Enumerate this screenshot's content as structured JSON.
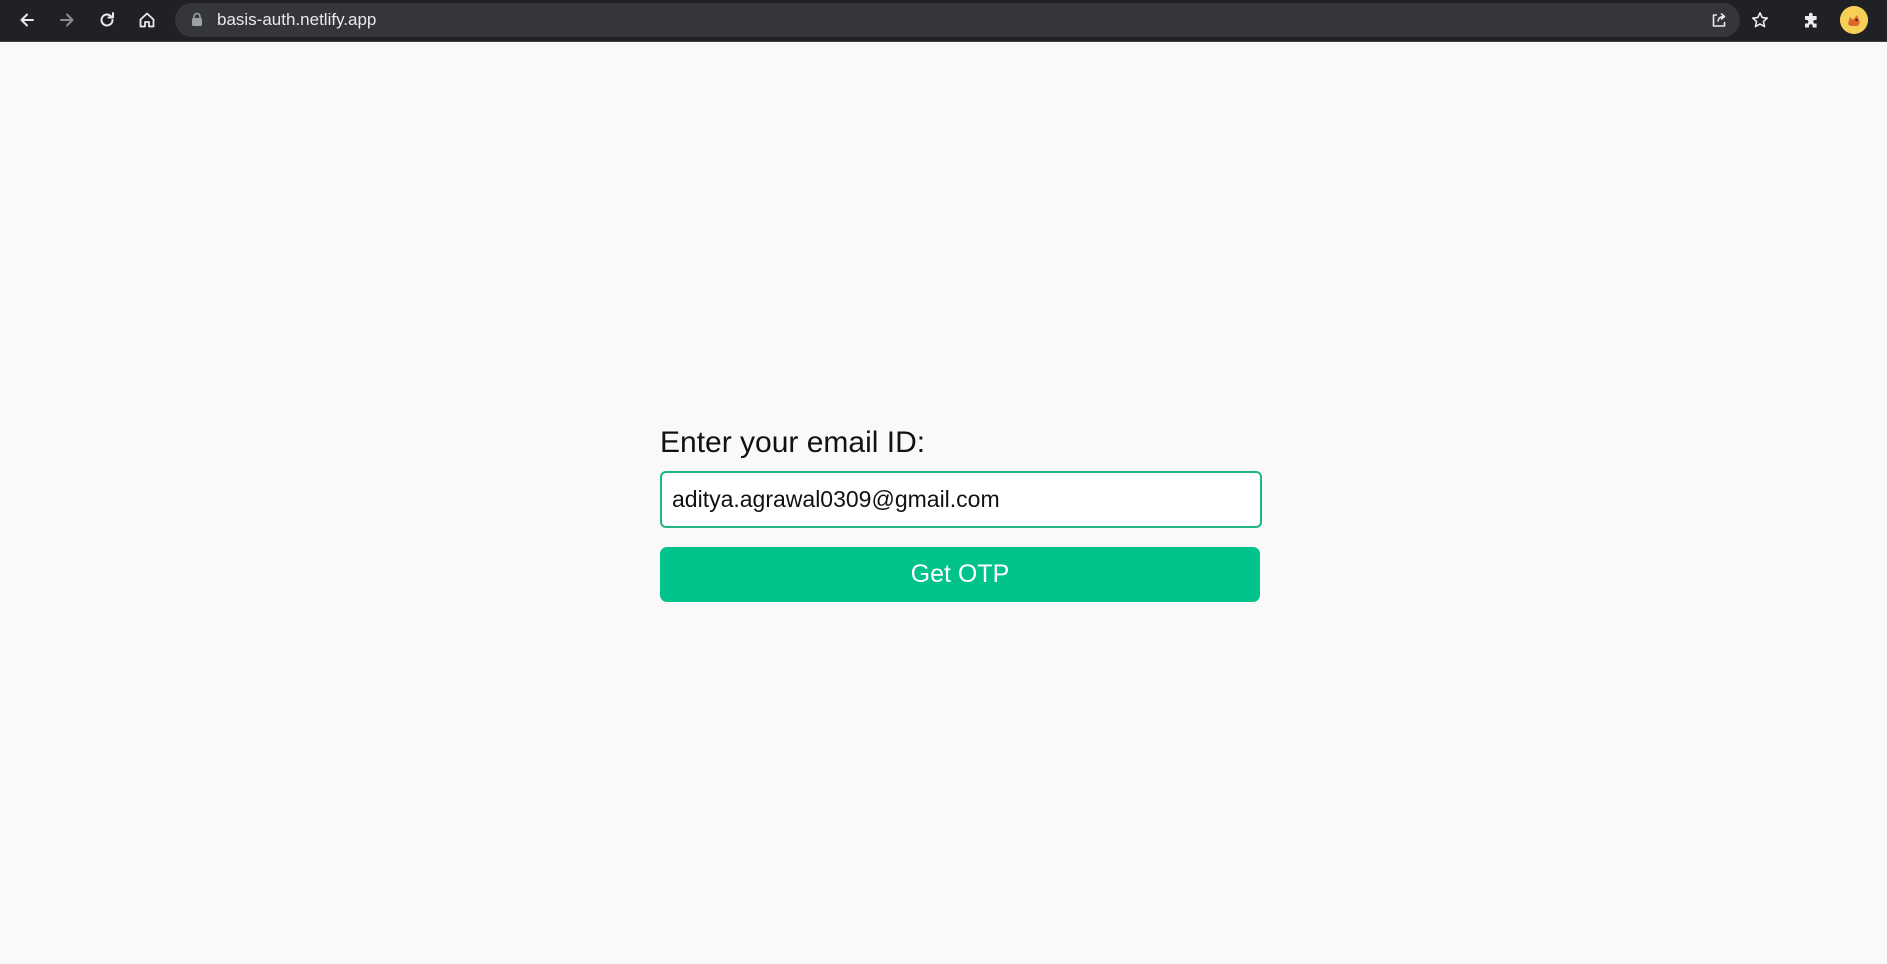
{
  "browser": {
    "url": "basis-auth.netlify.app",
    "toolbar_colors": {
      "background": "#202124",
      "omnibox": "#35363a"
    },
    "icons": [
      "back-arrow-icon",
      "forward-arrow-icon",
      "reload-icon",
      "home-icon",
      "lock-icon",
      "share-icon",
      "bookmark-star-icon",
      "extensions-puzzle-icon",
      "profile-avatar"
    ]
  },
  "form": {
    "label": "Enter your email ID:",
    "email_value": "aditya.agrawal0309@gmail.com",
    "submit_label": "Get OTP"
  },
  "colors": {
    "accent": "#00c38c",
    "input_border": "#1fb589",
    "page_background": "#f9f9f9"
  }
}
